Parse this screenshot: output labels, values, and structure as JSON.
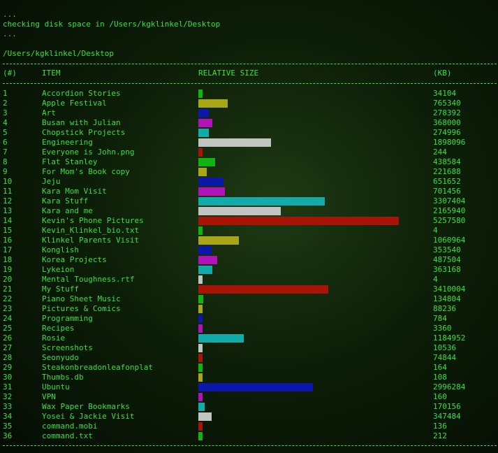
{
  "log": {
    "line1": "...",
    "line2": "checking disk space in /Users/kgklinkel/Desktop",
    "line3": "...",
    "path": "/Users/kgklinkel/Desktop"
  },
  "columns": {
    "num": "(#)",
    "item": "ITEM",
    "relative": "RELATIVE SIZE",
    "kb": "(KB)"
  },
  "palette": {
    "green": "#0fb40f",
    "olive": "#a8a517",
    "blue": "#0c18a8",
    "magenta": "#b014b8",
    "cyan": "#13aaaa",
    "grey": "#c2c4c2",
    "red": "#a81507",
    "text": "#39e13a"
  },
  "max_kb": 5257580,
  "items": [
    {
      "n": "1",
      "name": "Accordion Stories",
      "kb": "34104",
      "color": "green"
    },
    {
      "n": "2",
      "name": "Apple Festival",
      "kb": "765340",
      "color": "olive"
    },
    {
      "n": "3",
      "name": "Art",
      "kb": "278392",
      "color": "blue"
    },
    {
      "n": "4",
      "name": "Busan with Julian",
      "kb": "368000",
      "color": "magenta"
    },
    {
      "n": "5",
      "name": "Chopstick Projects",
      "kb": "274996",
      "color": "cyan"
    },
    {
      "n": "6",
      "name": "Engineering",
      "kb": "1898096",
      "color": "grey"
    },
    {
      "n": "7",
      "name": "Everyone is John.png",
      "kb": "244",
      "color": "red"
    },
    {
      "n": "8",
      "name": "Flat Stanley",
      "kb": "438584",
      "color": "green"
    },
    {
      "n": "9",
      "name": "For Mom's Book copy",
      "kb": "221688",
      "color": "olive"
    },
    {
      "n": "10",
      "name": "Jeju",
      "kb": "651652",
      "color": "blue"
    },
    {
      "n": "11",
      "name": "Kara Mom Visit",
      "kb": "701456",
      "color": "magenta"
    },
    {
      "n": "12",
      "name": "Kara Stuff",
      "kb": "3307404",
      "color": "cyan"
    },
    {
      "n": "13",
      "name": "Kara and me",
      "kb": "2165940",
      "color": "grey"
    },
    {
      "n": "14",
      "name": "Kevin's Phone Pictures",
      "kb": "5257580",
      "color": "red"
    },
    {
      "n": "15",
      "name": "Kevin_Klinkel_bio.txt",
      "kb": "4",
      "color": "green"
    },
    {
      "n": "16",
      "name": "Klinkel Parents Visit",
      "kb": "1060964",
      "color": "olive"
    },
    {
      "n": "17",
      "name": "Konglish",
      "kb": "353540",
      "color": "blue"
    },
    {
      "n": "18",
      "name": "Korea Projects",
      "kb": "487504",
      "color": "magenta"
    },
    {
      "n": "19",
      "name": "Lykeion",
      "kb": "363168",
      "color": "cyan"
    },
    {
      "n": "20",
      "name": "Mental Toughness.rtf",
      "kb": "4",
      "color": "grey"
    },
    {
      "n": "21",
      "name": "My Stuff",
      "kb": "3410004",
      "color": "red"
    },
    {
      "n": "22",
      "name": "Piano Sheet Music",
      "kb": "134804",
      "color": "green"
    },
    {
      "n": "23",
      "name": "Pictures & Comics",
      "kb": "88236",
      "color": "olive"
    },
    {
      "n": "24",
      "name": "Programming",
      "kb": "784",
      "color": "blue"
    },
    {
      "n": "25",
      "name": "Recipes",
      "kb": "3360",
      "color": "magenta"
    },
    {
      "n": "26",
      "name": "Rosie",
      "kb": "1184952",
      "color": "cyan"
    },
    {
      "n": "27",
      "name": "Screenshots",
      "kb": "10536",
      "color": "grey"
    },
    {
      "n": "28",
      "name": "Seonyudo",
      "kb": "74844",
      "color": "red"
    },
    {
      "n": "29",
      "name": "Steakonbreadonleafonplat",
      "kb": "164",
      "color": "green"
    },
    {
      "n": "30",
      "name": "Thumbs.db",
      "kb": "108",
      "color": "olive"
    },
    {
      "n": "31",
      "name": "Ubuntu",
      "kb": "2996284",
      "color": "blue"
    },
    {
      "n": "32",
      "name": "VPN",
      "kb": "160",
      "color": "magenta"
    },
    {
      "n": "33",
      "name": "Wax Paper Bookmarks",
      "kb": "170156",
      "color": "cyan"
    },
    {
      "n": "34",
      "name": "Yosei & Jackie Visit",
      "kb": "347484",
      "color": "grey"
    },
    {
      "n": "35",
      "name": "command.mobi",
      "kb": "136",
      "color": "red"
    },
    {
      "n": "36",
      "name": "command.txt",
      "kb": "212",
      "color": "green"
    }
  ]
}
